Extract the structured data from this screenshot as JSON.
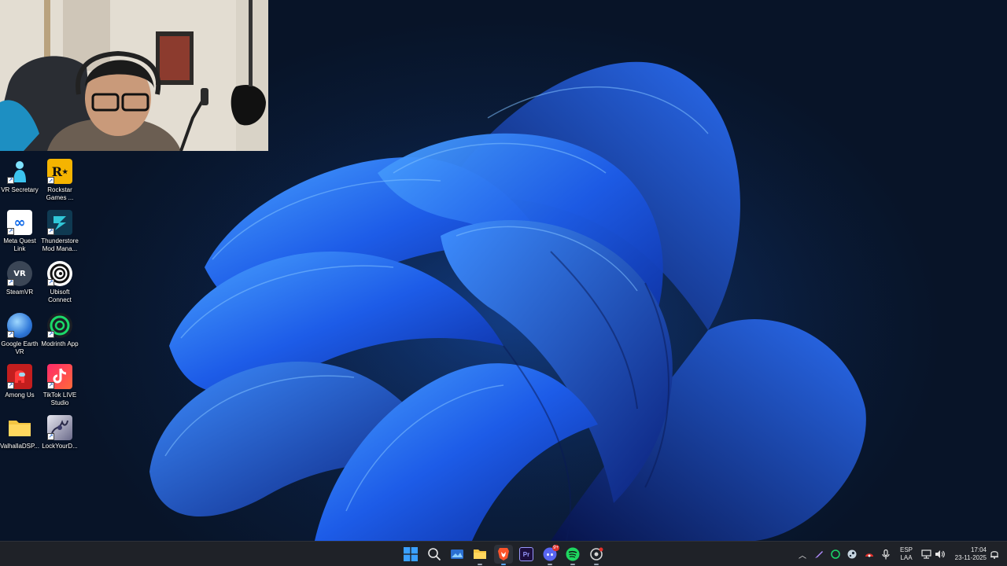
{
  "desktop_icons": [
    {
      "label": "VR Secretary",
      "icon": "vr-secretary-icon"
    },
    {
      "label": "Rockstar Games ...",
      "icon": "rockstar-games-icon"
    },
    {
      "label": "Meta Quest Link",
      "icon": "meta-quest-link-icon"
    },
    {
      "label": "Thunderstore Mod Mana...",
      "icon": "thunderstore-icon"
    },
    {
      "label": "SteamVR",
      "icon": "steamvr-icon"
    },
    {
      "label": "Ubisoft Connect",
      "icon": "ubisoft-connect-icon"
    },
    {
      "label": "Google Earth VR",
      "icon": "google-earth-vr-icon"
    },
    {
      "label": "Modrinth App",
      "icon": "modrinth-icon"
    },
    {
      "label": "Among Us",
      "icon": "among-us-icon"
    },
    {
      "label": "TikTok LIVE Studio",
      "icon": "tiktok-live-studio-icon"
    },
    {
      "label": "ValhallaDSP...",
      "icon": "folder-icon"
    },
    {
      "label": "LockYourD...",
      "icon": "lockyourd-icon"
    }
  ],
  "taskbar": {
    "apps": [
      "start-icon",
      "search-icon",
      "task-view-icon",
      "file-explorer-icon",
      "brave-browser-icon",
      "premiere-pro-icon",
      "discord-icon",
      "spotify-icon",
      "steam-settings-icon"
    ],
    "discord_badge": "9+",
    "premiere_label": "Pr",
    "tray_language_top": "ESP",
    "tray_language_bottom": "LAA",
    "time": "17:04",
    "date": "23-11-2025"
  },
  "colors": {
    "wallpaper_bloom": "#1f5ee8",
    "taskbar_bg": "#1f2228",
    "accent": "#0a84ff"
  }
}
